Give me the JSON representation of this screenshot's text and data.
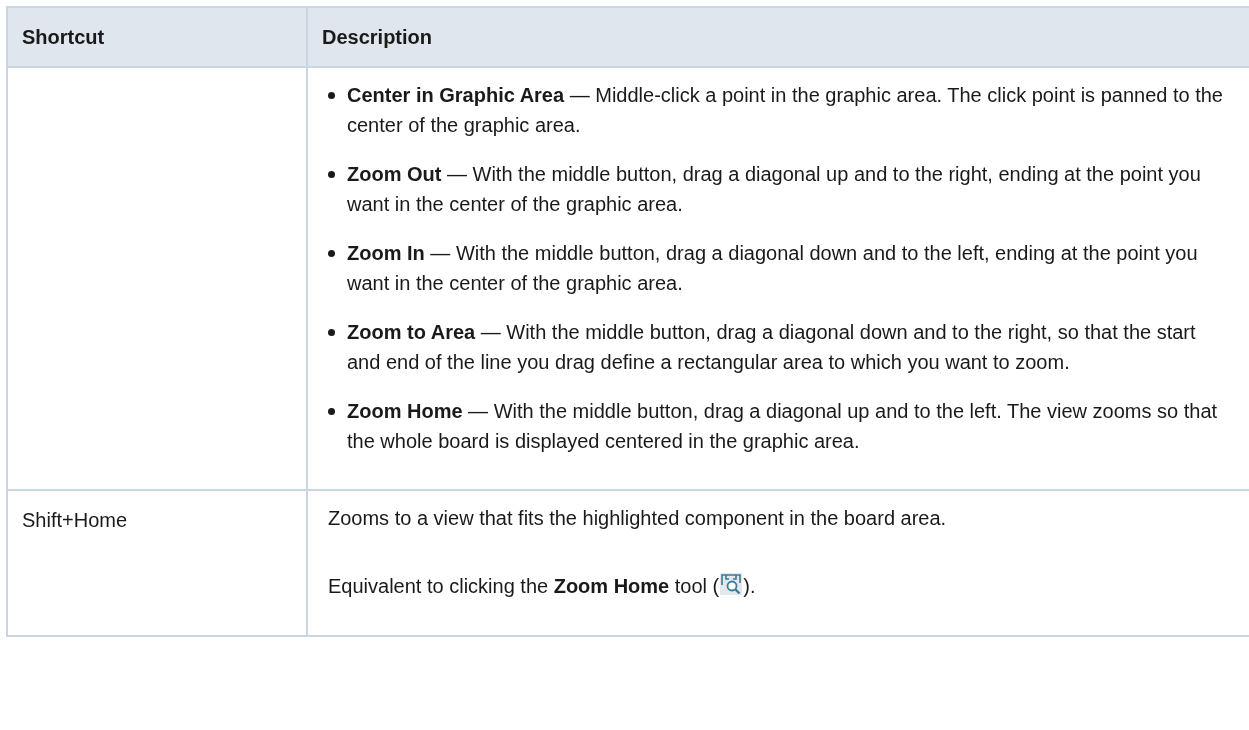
{
  "table": {
    "columns": [
      "Shortcut",
      "Description"
    ],
    "rows": [
      {
        "shortcut": "",
        "bullets": [
          "**Center in Graphic Area** — Middle-click a point in the graphic area. The click point is panned to the center of the graphic area.",
          "**Zoom Out** — With the middle button, drag a diagonal up and to the right, ending at the point you want in the center of the graphic area.",
          "**Zoom In** — With the middle button, drag a diagonal down and to the left, ending at the point you want in the center of the graphic area.",
          "**Zoom to Area** — With the middle button, drag a diagonal down and to the right, so that the start and end of the line you drag define a rectangular area to which you want to zoom.",
          "**Zoom Home** — With the middle button, drag a diagonal up and to the left. The view zooms so that the whole board is displayed centered in the graphic area."
        ]
      },
      {
        "shortcut": "Shift+Home",
        "paragraphs": [
          "Zooms to a view that fits the highlighted component in the board area."
        ],
        "note": {
          "before": "Equivalent to clicking the **Zoom Home** tool (",
          "after": ")."
        }
      }
    ]
  }
}
